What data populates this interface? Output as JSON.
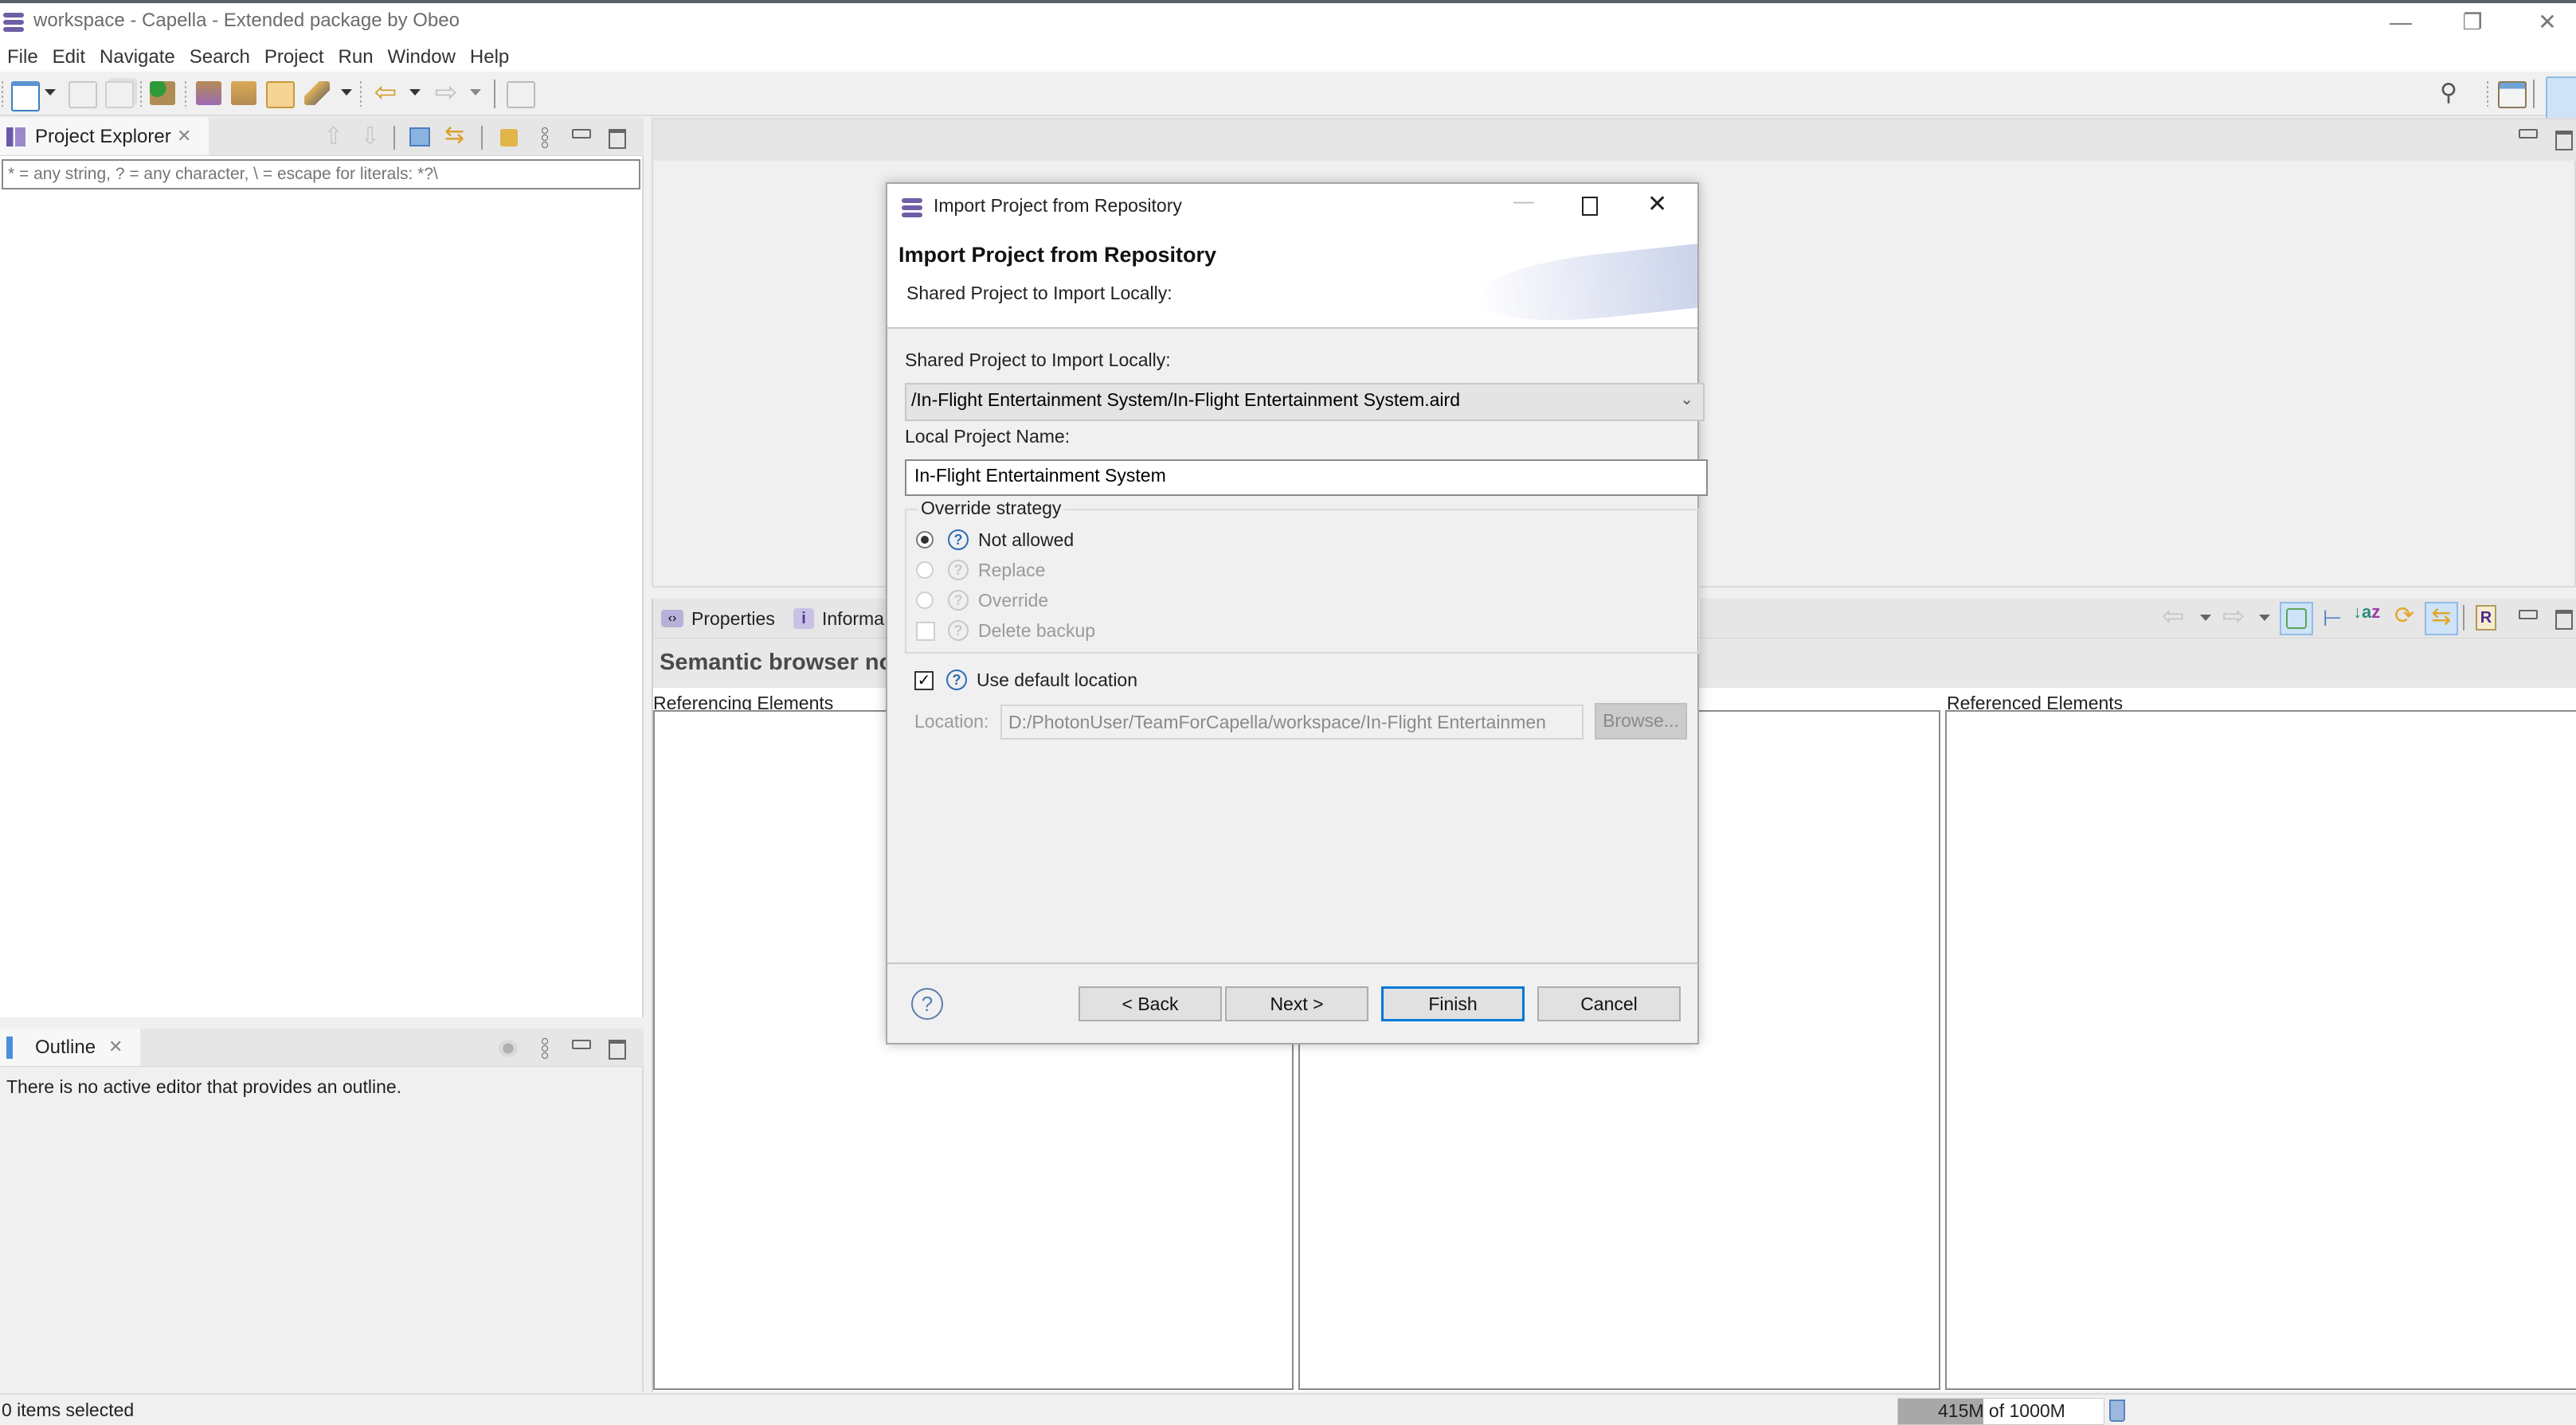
{
  "window": {
    "title": "workspace - Capella - Extended package by Obeo",
    "controls": {
      "minimize": "—",
      "restore": "❐",
      "close": "✕"
    }
  },
  "menu": [
    "File",
    "Edit",
    "Navigate",
    "Search",
    "Project",
    "Run",
    "Window",
    "Help"
  ],
  "toolbar": {
    "icons": [
      "new-wizard-icon",
      "save-icon",
      "save-all-icon",
      "run-icon",
      "capella-project-icon",
      "capella-model-icon",
      "open-folder-icon",
      "pen-icon",
      "back-arrow-icon",
      "forward-arrow-icon",
      "edit-icon"
    ],
    "right_icons": [
      "search-icon",
      "open-perspective-icon",
      "capella-perspective-icon"
    ]
  },
  "project_explorer": {
    "tab_label": "Project Explorer",
    "filter_placeholder": "* = any string, ? = any character, \\ = escape for literals: *?\\"
  },
  "outline": {
    "tab_label": "Outline",
    "message": "There is no active editor that provides an outline."
  },
  "properties_panel": {
    "tabs": [
      "Properties",
      "Informa"
    ],
    "heading": "Semantic browser no",
    "columns": [
      "Referencing Elements",
      "",
      "Referenced Elements"
    ]
  },
  "status_bar": {
    "selection": "0 items selected",
    "heap_used": "415M",
    "heap_total": "1000M",
    "heap_text": "415M of 1000M",
    "heap_fraction": 0.415
  },
  "dialog": {
    "window_title": "Import Project from Repository",
    "header_title": "Import Project from Repository",
    "header_description": "Shared Project to Import Locally:",
    "shared_project_label": "Shared Project to Import Locally:",
    "shared_project_value": "/In-Flight Entertainment System/In-Flight Entertainment System.aird",
    "local_name_label": "Local Project Name:",
    "local_name_value": "In-Flight Entertainment System",
    "override_group_label": "Override strategy",
    "override_options": [
      {
        "label": "Not allowed",
        "checked": true,
        "enabled": true
      },
      {
        "label": "Replace",
        "checked": false,
        "enabled": false
      },
      {
        "label": "Override",
        "checked": false,
        "enabled": false
      }
    ],
    "delete_backup_label": "Delete backup",
    "use_default_location_label": "Use default location",
    "use_default_location_checked": true,
    "location_label": "Location:",
    "location_value": "D:/PhotonUser/TeamForCapella/workspace/In-Flight Entertainmen",
    "browse_label": "Browse...",
    "buttons": {
      "back": "< Back",
      "next": "Next >",
      "finish": "Finish",
      "cancel": "Cancel"
    },
    "accent_color": "#0078d7"
  }
}
